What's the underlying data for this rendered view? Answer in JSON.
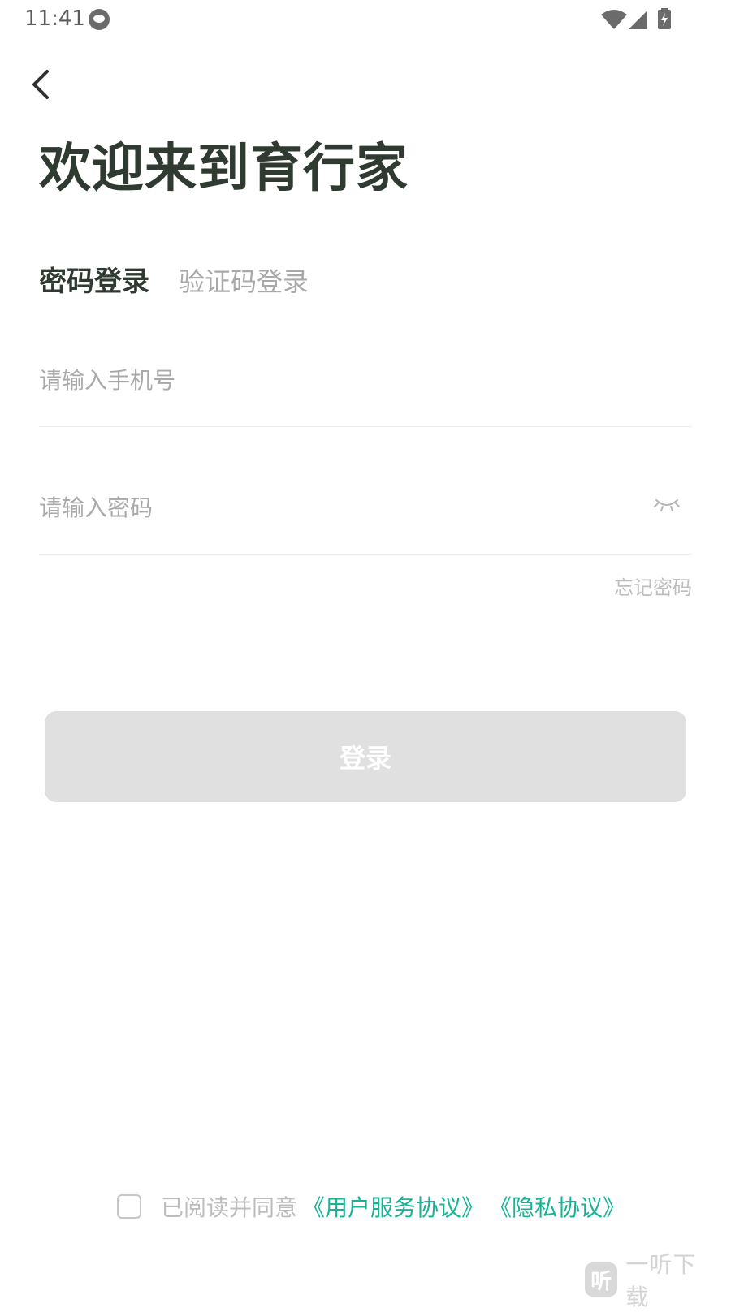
{
  "status_bar": {
    "time": "11:41"
  },
  "header": {
    "title": "欢迎来到育行家"
  },
  "tabs": [
    {
      "label": "密码登录",
      "active": true
    },
    {
      "label": "验证码登录",
      "active": false
    }
  ],
  "form": {
    "phone_placeholder": "请输入手机号",
    "password_placeholder": "请输入密码",
    "forgot_label": "忘记密码",
    "login_label": "登录"
  },
  "agreement": {
    "prefix": "已阅读并同意",
    "user_terms": "《用户服务协议》",
    "privacy": "《隐私协议》"
  },
  "watermark": {
    "badge": "听",
    "text": "一听下载"
  },
  "colors": {
    "title": "#2f3a31",
    "link": "#17b395",
    "button_disabled": "#dfe0df"
  }
}
